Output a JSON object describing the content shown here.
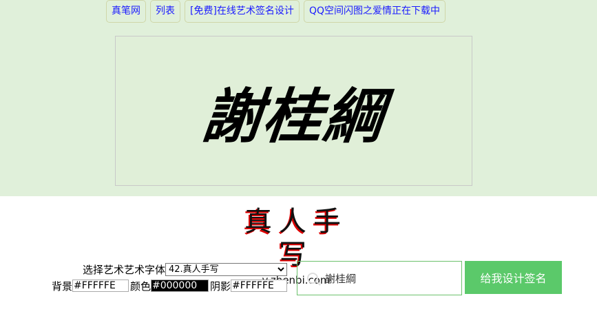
{
  "nav": [
    "真笔网",
    "列表",
    "[免费]在线艺术签名设计",
    "QQ空间闪图之爱情正在下载中"
  ],
  "signature_text": "謝桂綱",
  "logo": {
    "title": "真人手写",
    "url": "v.zhenbi.com"
  },
  "form": {
    "font_label": "选择艺术艺术字体",
    "font_selected": "42.真人手写",
    "bg_label": "背景",
    "bg_value": "#FFFFFE",
    "color_label": "颜色",
    "color_value": "#000000",
    "shadow_label": "阴影",
    "shadow_value": "#FFFFFE"
  },
  "search": {
    "value": "謝桂綱"
  },
  "submit_label": "给我设计签名"
}
